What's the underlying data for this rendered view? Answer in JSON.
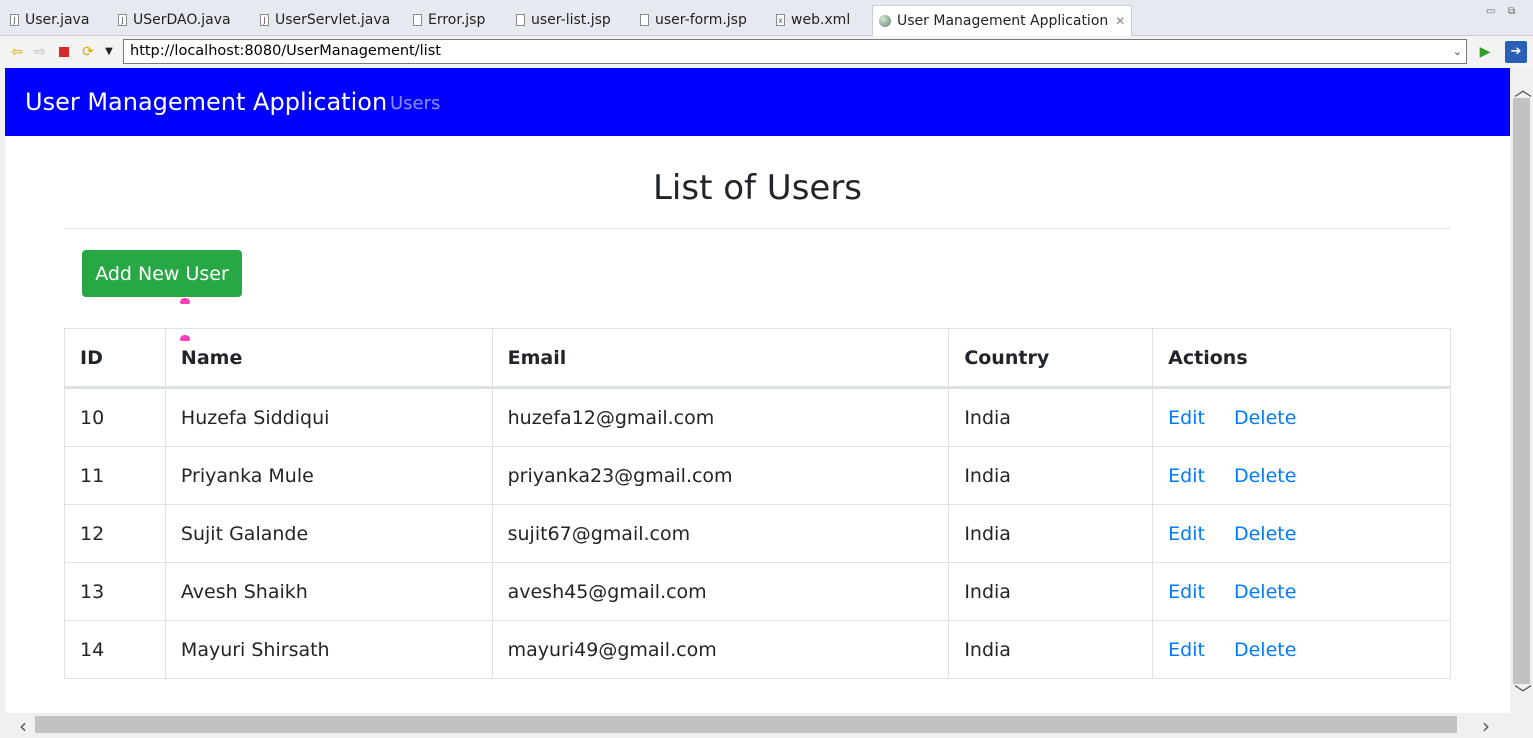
{
  "editor_tabs": [
    {
      "label": "User.java",
      "icon": "java-file-icon"
    },
    {
      "label": "USerDAO.java",
      "icon": "java-file-icon"
    },
    {
      "label": "UserServlet.java",
      "icon": "java-file-icon"
    },
    {
      "label": "Error.jsp",
      "icon": "jsp-file-icon"
    },
    {
      "label": "user-list.jsp",
      "icon": "jsp-file-icon"
    },
    {
      "label": "user-form.jsp",
      "icon": "jsp-file-icon"
    },
    {
      "label": "web.xml",
      "icon": "xml-file-icon"
    },
    {
      "label": "User Management Application",
      "icon": "globe-icon",
      "active": true
    }
  ],
  "browser": {
    "url": "http://localhost:8080/UserManagement/list"
  },
  "navbar": {
    "brand": "User Management Application",
    "link": "Users",
    "background": "#0000ff"
  },
  "main": {
    "title": "List of Users",
    "add_button": "Add New User",
    "add_button_color": "#28a745",
    "link_color": "#007bff"
  },
  "table": {
    "headers": [
      "ID",
      "Name",
      "Email",
      "Country",
      "Actions"
    ],
    "rows": [
      {
        "id": "10",
        "name": "Huzefa Siddiqui",
        "email": "huzefa12@gmail.com",
        "country": "India"
      },
      {
        "id": "11",
        "name": "Priyanka Mule",
        "email": "priyanka23@gmail.com",
        "country": "India"
      },
      {
        "id": "12",
        "name": "Sujit Galande",
        "email": "sujit67@gmail.com",
        "country": "India"
      },
      {
        "id": "13",
        "name": "Avesh Shaikh",
        "email": "avesh45@gmail.com",
        "country": "India"
      },
      {
        "id": "14",
        "name": "Mayuri Shirsath",
        "email": "mayuri49@gmail.com",
        "country": "India"
      }
    ],
    "edit_label": "Edit",
    "delete_label": "Delete"
  }
}
